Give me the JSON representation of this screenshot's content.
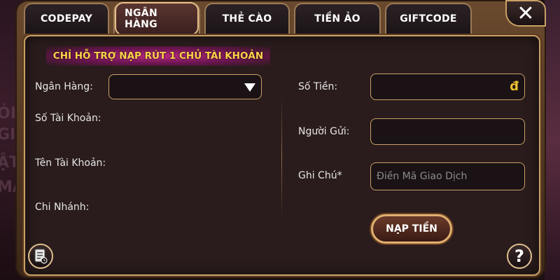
{
  "tabs": [
    {
      "label": "CODEPAY",
      "active": false
    },
    {
      "label": "NGÂN HÀNG",
      "active": true
    },
    {
      "label": "THẺ CÀO",
      "active": false
    },
    {
      "label": "TIỀN ẢO",
      "active": false
    },
    {
      "label": "GIFTCODE",
      "active": false
    }
  ],
  "close_label": "✕",
  "notice": "CHỈ HỖ TRỢ NẠP RÚT 1 CHỦ TÀI KHOẢN",
  "left_form": {
    "bank_label": "Ngân Hàng:",
    "bank_selected": "",
    "account_number_label": "Số Tài Khoản:",
    "account_name_label": "Tên Tài Khoản:",
    "branch_label": "Chi Nhánh:"
  },
  "right_form": {
    "amount_label": "Số Tiền:",
    "amount_value": "",
    "currency_symbol": "đ",
    "sender_label": "Người Gửi:",
    "sender_value": "",
    "note_label": "Ghi Chú*",
    "note_placeholder": "Điền Mã Giao Dịch",
    "note_value": ""
  },
  "submit_label": "NẠP TIỀN",
  "help_label": "?",
  "icons": {
    "history": "history-icon",
    "help": "help-icon",
    "close": "close-icon",
    "dropdown": "chevron-down-icon"
  },
  "colors": {
    "accent_gold": "#c9a066",
    "notice_text": "#ffd24a",
    "notice_glow": "#b82a80",
    "currency": "#f0c030"
  }
}
